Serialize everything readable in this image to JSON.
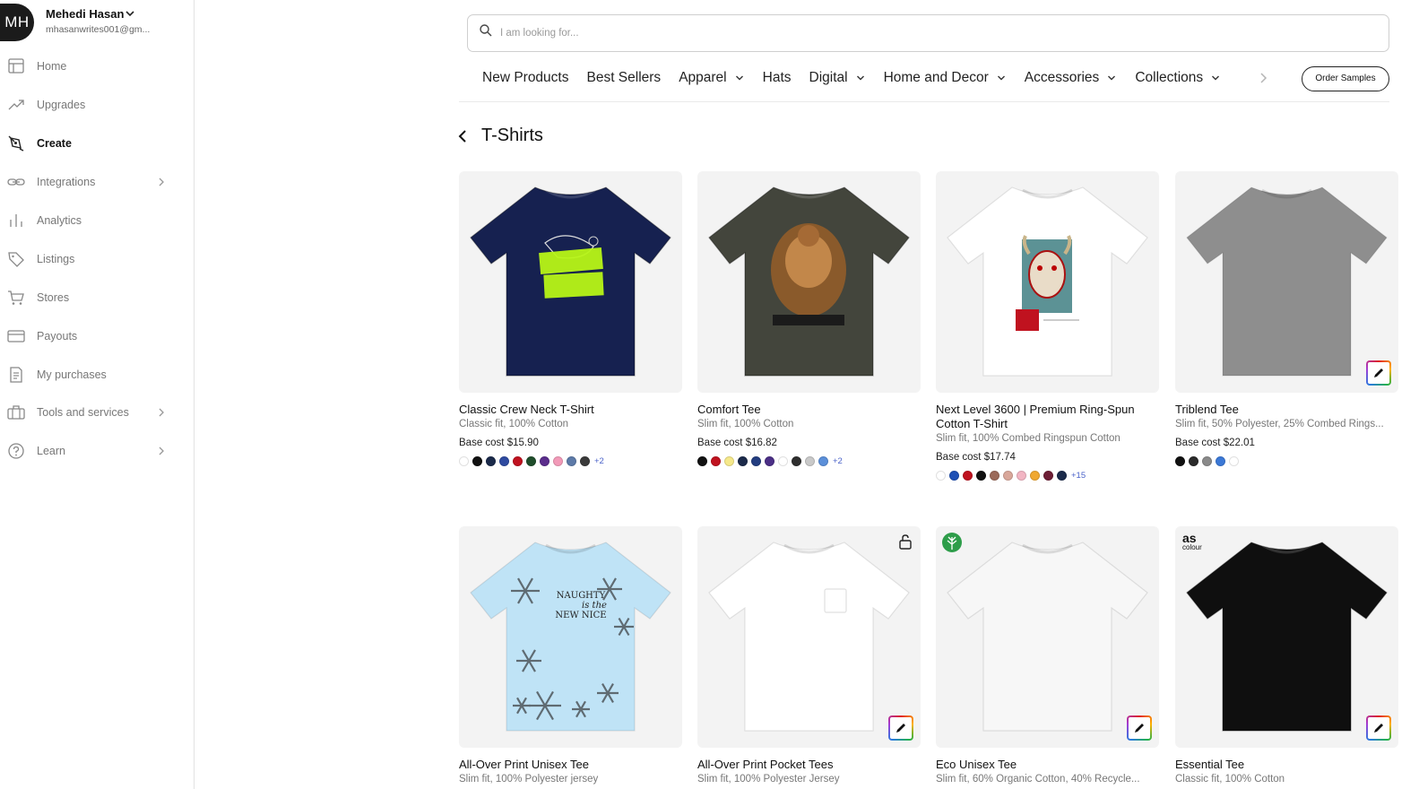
{
  "user": {
    "initials": "MH",
    "name": "Mehedi Hasan",
    "email": "mhasanwrites001@gm..."
  },
  "sidebar": {
    "items": [
      {
        "label": "Home",
        "icon": "home-icon"
      },
      {
        "label": "Upgrades",
        "icon": "trend-up-icon"
      },
      {
        "label": "Create",
        "icon": "pen-tool-icon",
        "active": true
      },
      {
        "label": "Integrations",
        "icon": "link-icon",
        "chevron": true
      },
      {
        "label": "Analytics",
        "icon": "bar-chart-icon"
      },
      {
        "label": "Listings",
        "icon": "tag-icon"
      },
      {
        "label": "Stores",
        "icon": "cart-icon"
      },
      {
        "label": "Payouts",
        "icon": "card-icon"
      },
      {
        "label": "My purchases",
        "icon": "receipt-icon"
      },
      {
        "label": "Tools and services",
        "icon": "toolbox-icon",
        "chevron": true
      },
      {
        "label": "Learn",
        "icon": "help-icon",
        "chevron": true
      }
    ]
  },
  "search": {
    "placeholder": "I am looking for..."
  },
  "categories": [
    {
      "label": "New Products",
      "dropdown": false
    },
    {
      "label": "Best Sellers",
      "dropdown": false
    },
    {
      "label": "Apparel",
      "dropdown": true
    },
    {
      "label": "Hats",
      "dropdown": false
    },
    {
      "label": "Digital",
      "dropdown": true
    },
    {
      "label": "Home and Decor",
      "dropdown": true
    },
    {
      "label": "Accessories",
      "dropdown": true
    },
    {
      "label": "Collections",
      "dropdown": true
    }
  ],
  "order_samples_label": "Order Samples",
  "page": {
    "title": "T-Shirts"
  },
  "products": [
    {
      "name": "Classic Crew Neck T-Shirt",
      "desc": "Classic fit, 100% Cotton",
      "cost": "Base cost $15.90",
      "swatches": [
        "#ffffff",
        "#111111",
        "#1b2a4a",
        "#2e4aa0",
        "#c0121f",
        "#1f4d2b",
        "#5b2d8c",
        "#f29ab8",
        "#5d7aa8",
        "#3a3a3a"
      ],
      "more": "+2",
      "shirt_color": "#162150",
      "design": "lost-in-reality-graphic"
    },
    {
      "name": "Comfort Tee",
      "desc": "Slim fit, 100% Cotton",
      "cost": "Base cost $16.82",
      "swatches": [
        "#111111",
        "#c0121f",
        "#f5e88a",
        "#1b2a4a",
        "#233d80",
        "#4b2f86",
        "#ffffff",
        "#2e2e2e",
        "#c9c9c9",
        "#5b8fd9"
      ],
      "more": "+2",
      "shirt_color": "#43453c",
      "design": "hercules-graphic"
    },
    {
      "name": "Next Level 3600 | Premium Ring-Spun Cotton T-Shirt",
      "desc": "Slim fit, 100% Combed Ringspun Cotton",
      "cost": "Base cost $17.74",
      "swatches": [
        "#ffffff",
        "#1d4fb5",
        "#c0121f",
        "#111111",
        "#9b6a5a",
        "#d9a79a",
        "#f2b5c3",
        "#f0a830",
        "#6e1e35",
        "#1b2a4a"
      ],
      "more": "+15",
      "shirt_color": "#ffffff",
      "design": "oni-mask-graphic"
    },
    {
      "name": "Triblend Tee",
      "desc": "Slim fit, 50% Polyester, 25% Combed Rings...",
      "cost": "Base cost $22.01",
      "swatches": [
        "#111111",
        "#2a2a2a",
        "#8a8a8a",
        "#3b78d6",
        "#ffffff"
      ],
      "more": "",
      "shirt_color": "#8e8e8e",
      "design": "plain",
      "editable": true
    },
    {
      "name": "All-Over Print Unisex Tee",
      "desc": "Slim fit, 100% Polyester jersey",
      "cost": "",
      "swatches": [],
      "more": "",
      "shirt_color": "#bfe3f6",
      "design": "naughty-snowflake-print",
      "print_text": [
        "NAUGHTY",
        "is the",
        "NEW NICE"
      ]
    },
    {
      "name": "All-Over Print Pocket Tees",
      "desc": "Slim fit, 100% Polyester Jersey",
      "cost": "",
      "swatches": [],
      "more": "",
      "shirt_color": "#ffffff",
      "design": "pocket",
      "editable": true,
      "locked": true
    },
    {
      "name": "Eco Unisex Tee",
      "desc": "Slim fit, 60% Organic Cotton, 40% Recycle...",
      "cost": "",
      "swatches": [],
      "more": "",
      "shirt_color": "#f7f7f7",
      "design": "plain",
      "editable": true,
      "eco": true
    },
    {
      "name": "Essential Tee",
      "desc": "Classic fit, 100% Cotton",
      "cost": "",
      "swatches": [],
      "more": "",
      "shirt_color": "#0f0f0f",
      "design": "plain",
      "editable": true,
      "brand": {
        "line1": "as",
        "line2": "colour"
      }
    }
  ]
}
